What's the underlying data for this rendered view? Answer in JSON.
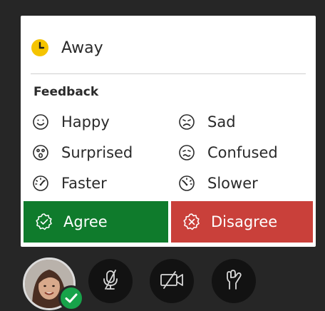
{
  "status_menu": {
    "away": {
      "label": "Away",
      "icon": "clock-icon",
      "icon_color": "#f5c400"
    },
    "feedback": {
      "heading": "Feedback",
      "items": [
        {
          "label": "Happy",
          "icon": "smile-icon"
        },
        {
          "label": "Sad",
          "icon": "frown-icon"
        },
        {
          "label": "Surprised",
          "icon": "surprised-icon"
        },
        {
          "label": "Confused",
          "icon": "confused-icon"
        },
        {
          "label": "Faster",
          "icon": "speed-fast-icon"
        },
        {
          "label": "Slower",
          "icon": "speed-slow-icon"
        }
      ]
    },
    "agree": {
      "label": "Agree",
      "icon": "check-badge-icon",
      "color": "#0f7b2c"
    },
    "disagree": {
      "label": "Disagree",
      "icon": "x-badge-icon",
      "color": "#c9403a"
    }
  },
  "controls": {
    "avatar_status_color": "#17a34a",
    "buttons": [
      {
        "name": "microphone-off-button",
        "icon": "mic-off-icon"
      },
      {
        "name": "camera-off-button",
        "icon": "camera-off-icon"
      },
      {
        "name": "share-content-button",
        "icon": "share-content-icon"
      }
    ]
  }
}
